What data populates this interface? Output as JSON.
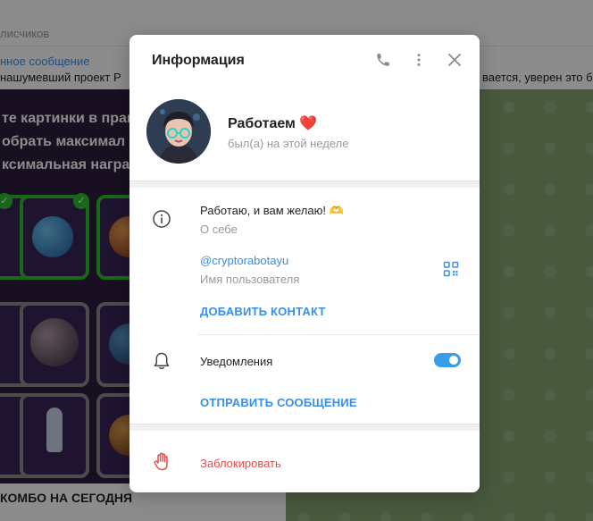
{
  "background": {
    "header_sub": "лисчиков",
    "pinned_title": "нное сообщение",
    "pinned_text": "нашумевший проект P",
    "pinned_text_right": "вается, уверен это б",
    "banner_lines": [
      "те картинки в прав",
      "обрать максимал",
      "ксимальная награ"
    ],
    "caption": "КОМБО НА СЕГОДНЯ"
  },
  "modal": {
    "title": "Информация",
    "profile": {
      "name": "Работаем ❤️",
      "status": "был(а) на этой неделе"
    },
    "info": {
      "bio": "Работаю, и вам желаю! 🫶",
      "bio_label": "О себе",
      "username": "@cryptorabotayu",
      "username_label": "Имя пользователя",
      "add_contact": "ДОБАВИТЬ КОНТАКТ"
    },
    "notifications": {
      "label": "Уведомления",
      "enabled": true
    },
    "send_message": "ОТПРАВИТЬ СООБЩЕНИЕ",
    "block": "Заблокировать"
  },
  "colors": {
    "accent": "#3a8ee6",
    "danger": "#e0504e",
    "toggle": "#3a9ee6"
  },
  "icons": [
    "phone-icon",
    "more-vertical-icon",
    "close-icon",
    "info-icon",
    "qr-code-icon",
    "bell-icon",
    "hand-block-icon"
  ]
}
